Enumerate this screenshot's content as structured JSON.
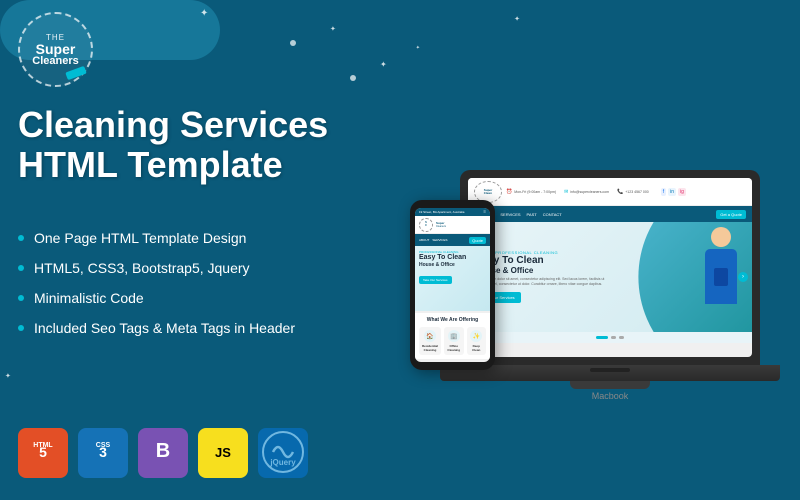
{
  "logo": {
    "tagline": "THE",
    "brand_line1": "Super",
    "brand_line2": "Cleaners"
  },
  "heading": {
    "line1": "Cleaning Services",
    "line2": "HTML Template"
  },
  "features": [
    "One Page HTML Template Design",
    "HTML5, CSS3, Bootstrap5, Jquery",
    "Minimalistic Code",
    "Included Seo Tags & Meta Tags in Header"
  ],
  "badges": [
    {
      "id": "html5",
      "label": "5",
      "prefix": "HTML"
    },
    {
      "id": "css3",
      "label": "3",
      "prefix": "CSS"
    },
    {
      "id": "bootstrap",
      "label": "B",
      "prefix": ""
    },
    {
      "id": "js",
      "label": "JS",
      "prefix": ""
    },
    {
      "id": "jquery",
      "label": "jQuery",
      "prefix": ""
    }
  ],
  "site_preview": {
    "hero_tag": "HIGHLY PROFESSIONAL CLEANING",
    "hero_title": "Easy To Clean",
    "hero_subtitle": "House & Office",
    "hero_btn": "Take Our Services",
    "nav_items": [
      "ABOUT US",
      "SERVICES",
      "PAST",
      "CONTACT"
    ],
    "nav_cta": "Get a Quote",
    "phone_nav_items": [
      "☰"
    ]
  },
  "macbook_label": "Macbook",
  "colors": {
    "bg": "#0a5a7a",
    "accent": "#00bcd4",
    "html_badge": "#e34f26",
    "css_badge": "#1572b6",
    "bootstrap_badge": "#7952b3",
    "js_badge": "#f7df1e",
    "jquery_badge": "#0769ad"
  }
}
